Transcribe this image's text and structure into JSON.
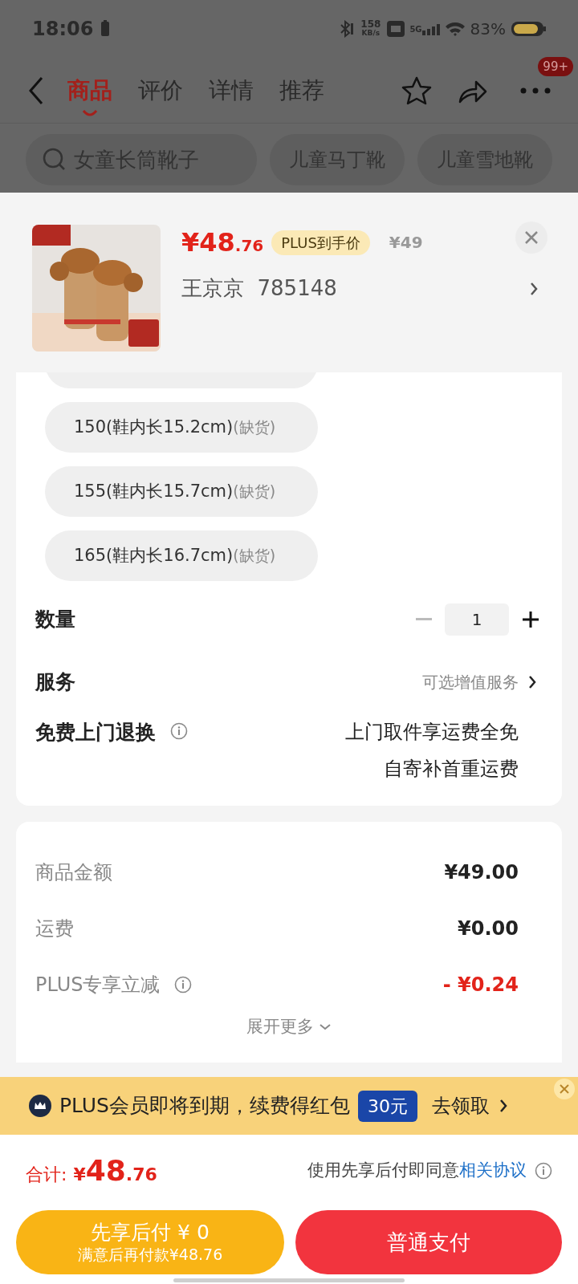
{
  "status_bar": {
    "time": "18:06",
    "speed": "158",
    "speed_unit": "KB/s",
    "network": "5G",
    "battery": "83%"
  },
  "nav": {
    "tabs": [
      {
        "label": "商品",
        "selected": true
      },
      {
        "label": "评价",
        "selected": false
      },
      {
        "label": "详情",
        "selected": false
      },
      {
        "label": "推荐",
        "selected": false
      }
    ],
    "badge": "99+"
  },
  "search": {
    "placeholder": "女童长筒靴子",
    "chips": [
      "儿童马丁靴",
      "儿童雪地靴"
    ]
  },
  "product": {
    "price_main": "¥48",
    "price_decimal": ".76",
    "price_tag": "PLUS到手价",
    "original_price": "¥49",
    "variant": "王京京  785148"
  },
  "sizes": [
    {
      "label": "150(鞋内长15.2cm)",
      "status": "(缺货)"
    },
    {
      "label": "155(鞋内长15.7cm)",
      "status": "(缺货)"
    },
    {
      "label": "165(鞋内长16.7cm)",
      "status": "(缺货)"
    }
  ],
  "quantity": {
    "label": "数量",
    "value": "1"
  },
  "service": {
    "label": "服务",
    "value": "可选增值服务"
  },
  "returns": {
    "label": "免费上门退换",
    "lines": [
      "上门取件享运费全免",
      "自寄补首重运费"
    ]
  },
  "summary": {
    "rows": [
      {
        "label": "商品金额",
        "value": "¥49.00",
        "kind": "normal"
      },
      {
        "label": "运费",
        "value": "¥0.00",
        "kind": "normal"
      },
      {
        "label": "PLUS专享立减",
        "value": "- ¥0.24",
        "kind": "discount"
      }
    ],
    "expand": "展开更多"
  },
  "banner": {
    "text": "PLUS会员即将到期，续费得红包",
    "amount": "30元",
    "action": "去领取"
  },
  "total": {
    "label": "合计:",
    "currency": "¥",
    "main": "48",
    "decimal": ".76",
    "agreement": "使用先享后付即同意",
    "link": "相关协议"
  },
  "buttons": {
    "later": {
      "title": "先享后付 ¥ 0",
      "subtitle": "满意后再付款¥48.76"
    },
    "pay": "普通支付"
  }
}
